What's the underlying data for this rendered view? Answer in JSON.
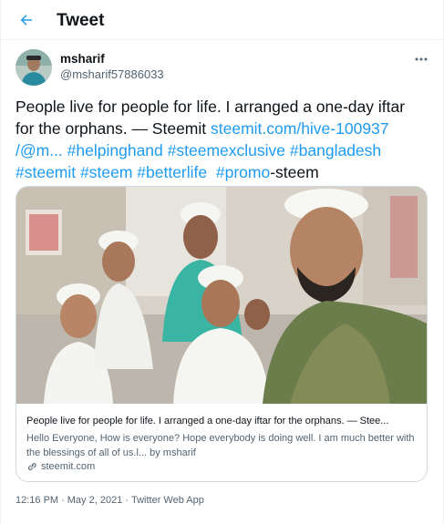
{
  "header": {
    "title": "Tweet",
    "back_icon": "arrow-left-icon"
  },
  "author": {
    "name": "msharif",
    "handle": "@msharif57886033"
  },
  "tweet": {
    "text_line1": "People live for people for life. I arranged a one-day iftar",
    "text_line2a": "for the orphans. — Steemit ",
    "link1": "steemit.com/hive-100937",
    "link2": "/@m...",
    "tag1": "#helpinghand",
    "tag2": "#steemexclusive",
    "tag3": "#bangladesh",
    "tag4": "#steemit",
    "tag5": "#steem",
    "tag6": "#betterlife",
    "tag7": "#promo",
    "tag7_suffix": "-steem"
  },
  "card": {
    "title": "People live for people for life. I arranged a one-day iftar for the orphans. — Stee...",
    "description": "Hello Everyone, How is everyone? Hope everybody is doing well. I am much better with the blessings of all of us.l... by msharif",
    "domain": "steemit.com"
  },
  "meta": {
    "time": "12:16 PM",
    "date": "May 2, 2021",
    "source": "Twitter Web App",
    "separator": "·"
  },
  "colors": {
    "accent": "#1d9bf0",
    "text": "#0f1419",
    "muted": "#536471",
    "border": "#cfd9de"
  }
}
